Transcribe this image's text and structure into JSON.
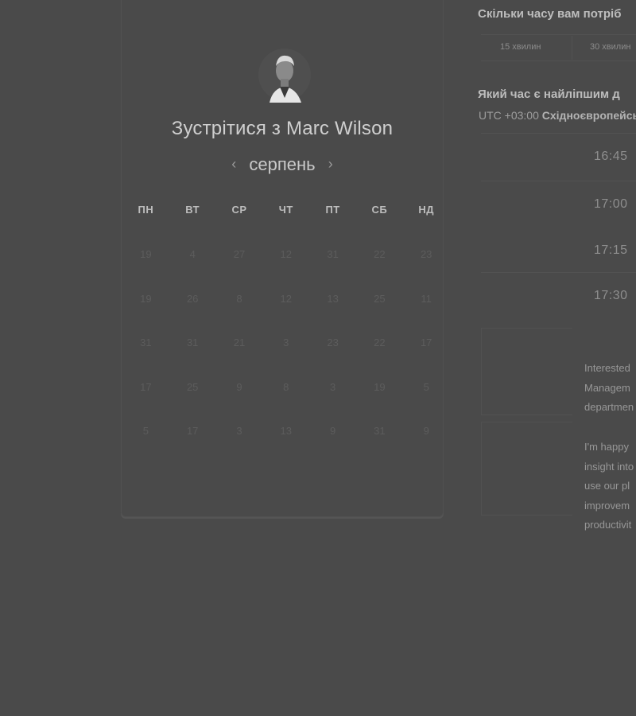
{
  "booking": {
    "title": "Зустрітися з Marc Wilson",
    "month": "серпень",
    "prev_arrow": "‹",
    "next_arrow": "›",
    "weekdays": [
      "ПН",
      "ВТ",
      "СР",
      "ЧТ",
      "ПТ",
      "СБ",
      "НД"
    ],
    "rows": [
      [
        "19",
        "4",
        "27",
        "12",
        "31",
        "22",
        "23"
      ],
      [
        "19",
        "26",
        "8",
        "12",
        "13",
        "25",
        "11"
      ],
      [
        "31",
        "31",
        "21",
        "3",
        "23",
        "22",
        "17"
      ],
      [
        "17",
        "25",
        "9",
        "8",
        "3",
        "19",
        "5"
      ],
      [
        "5",
        "17",
        "3",
        "13",
        "9",
        "31",
        "9"
      ]
    ]
  },
  "right": {
    "duration_question": "Скільки часу вам потріб",
    "durations": [
      "15 хвилин",
      "30 хвилин"
    ],
    "time_question": "Який час є найліпшим д",
    "timezone_offset": "UTC +03:00",
    "timezone_name": "Східноєвропейсь",
    "slots": [
      "16:45",
      "17:00",
      "17:15",
      "17:30"
    ],
    "paragraph1": [
      "Interested",
      "Managem",
      "departmen"
    ],
    "paragraph2": [
      "I'm happy",
      "insight into",
      "use our pl",
      "improvem",
      "productivit"
    ]
  },
  "colors": {
    "background": "#4a4a4a",
    "text_primary": "#cfcfcf",
    "text_muted": "#5c5c5c"
  }
}
